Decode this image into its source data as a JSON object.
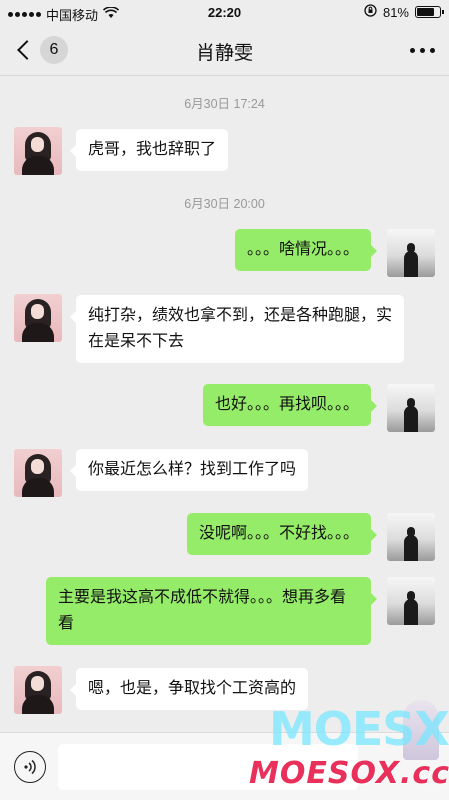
{
  "status_bar": {
    "carrier": "中国移动",
    "time": "22:20",
    "battery_percent": "81%",
    "battery_level": 0.81
  },
  "nav": {
    "back_count": "6",
    "title": "肖静雯",
    "more_icon": "more-dots-icon"
  },
  "messages": [
    {
      "type": "timestamp",
      "text": "6月30日 17:24"
    },
    {
      "type": "in",
      "text": "虎哥，我也辞职了"
    },
    {
      "type": "timestamp",
      "text": "6月30日 20:00"
    },
    {
      "type": "out",
      "text": "。。。啥情况。。。"
    },
    {
      "type": "in",
      "text": "纯打杂，绩效也拿不到，还是各种跑腿，实在是呆不下去"
    },
    {
      "type": "out",
      "text": "也好。。。再找呗。。。"
    },
    {
      "type": "in",
      "text": "你最近怎么样？找到工作了吗"
    },
    {
      "type": "out",
      "text": "没呢啊。。。不好找。。。"
    },
    {
      "type": "out",
      "text": "主要是我这高不成低不就得。。。想再多看看"
    },
    {
      "type": "in",
      "text": "嗯，也是，争取找个工资高的"
    }
  ],
  "input_bar": {
    "voice_icon": "voice-icon",
    "placeholder": ""
  },
  "watermark": {
    "top": "MOESX",
    "bottom": "MOESOX.cc"
  }
}
